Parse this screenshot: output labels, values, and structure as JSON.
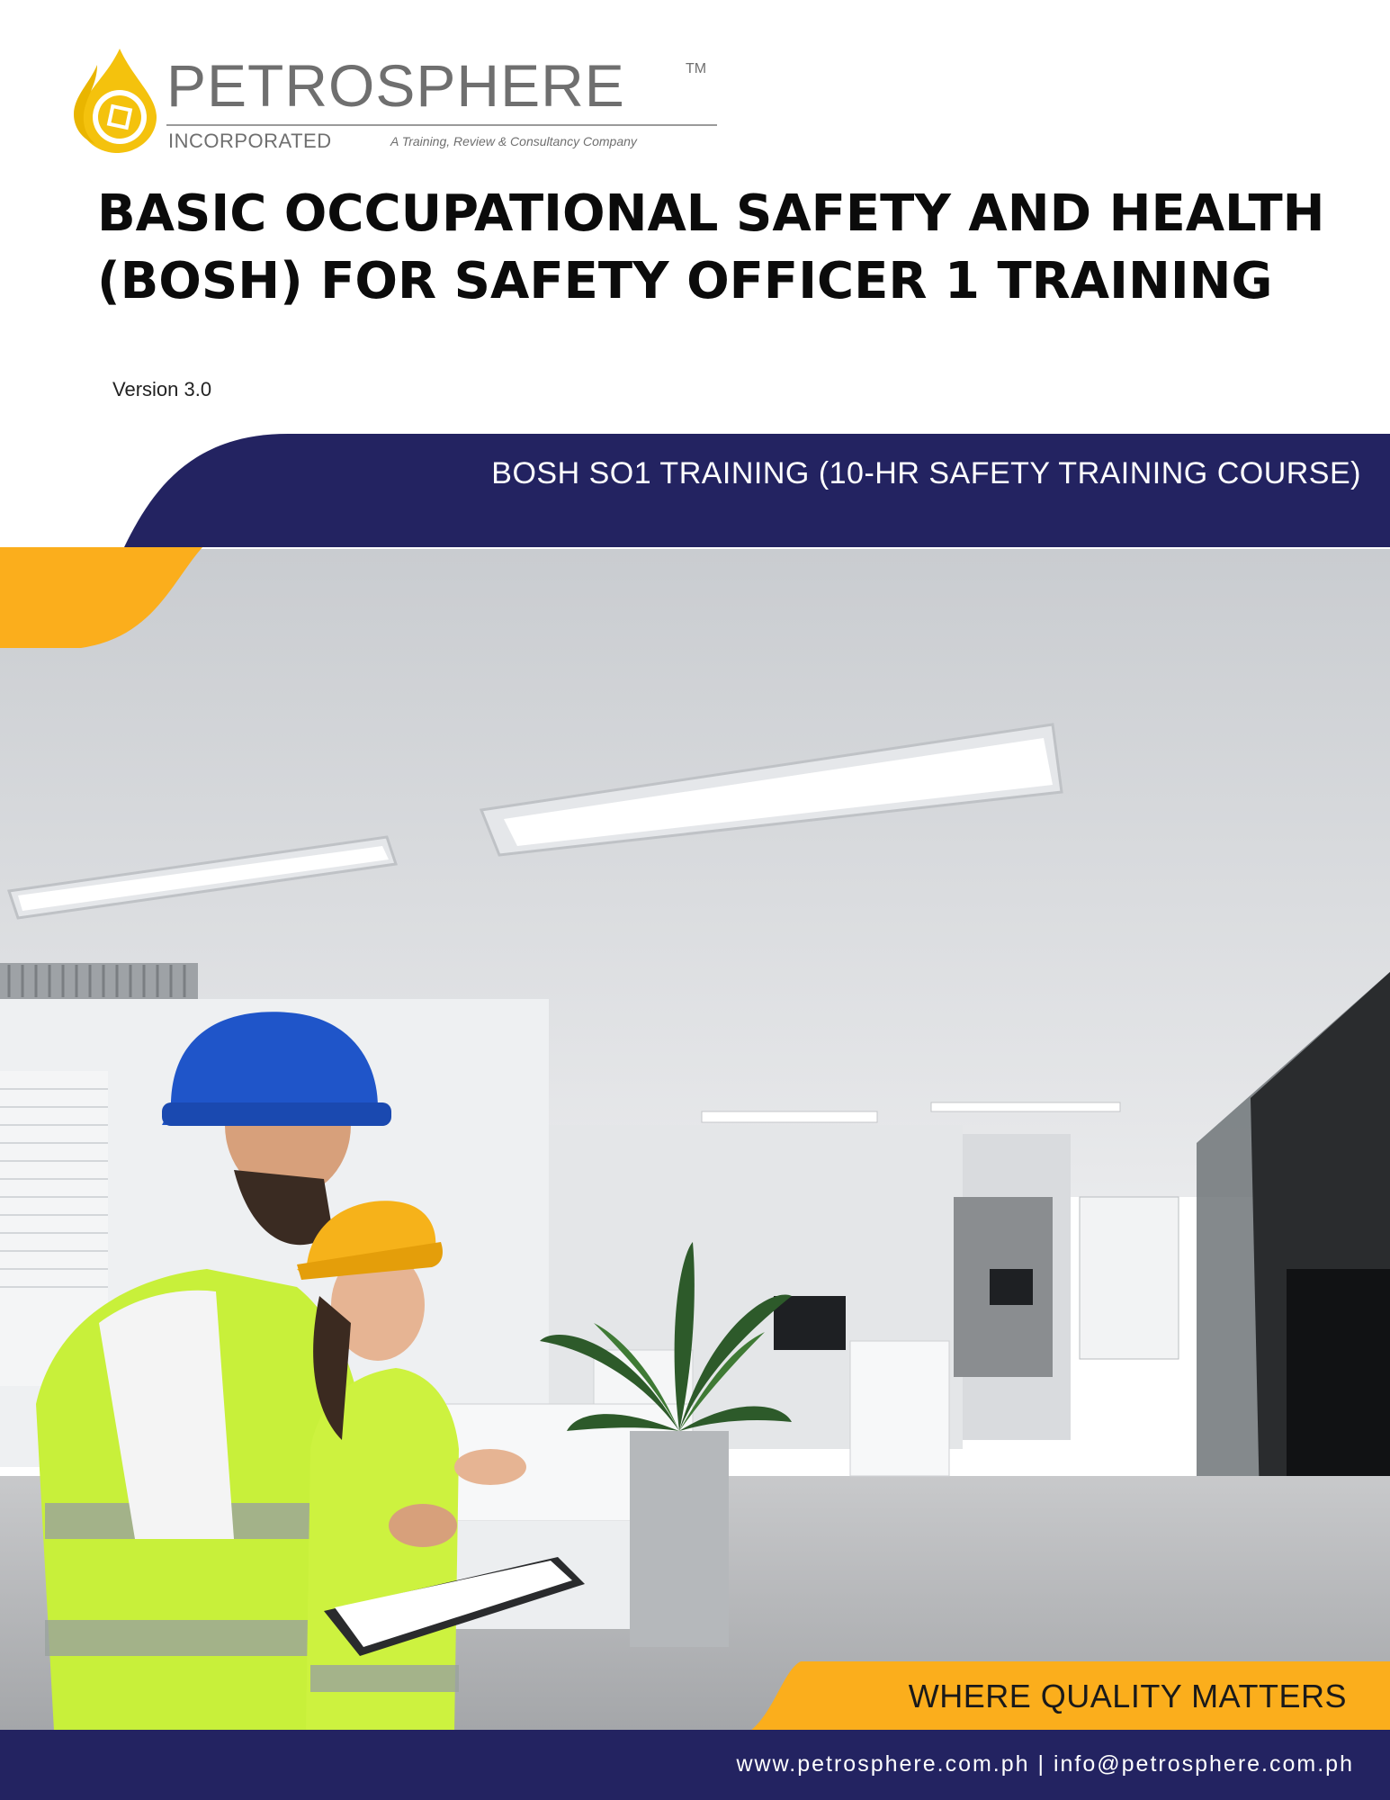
{
  "logo": {
    "name": "PETROSPHERE",
    "trademark": "TM",
    "subname": "INCORPORATED",
    "tagline": "A Training, Review & Consultancy Company"
  },
  "title": "BASIC OCCUPATIONAL SAFETY AND HEALTH (BOSH) FOR SAFETY OFFICER 1 TRAINING",
  "version": "Version 3.0",
  "band_text": "BOSH SO1 TRAINING (10-HR SAFETY TRAINING COURSE)",
  "tagline": "WHERE QUALITY MATTERS",
  "footer_contact": "www.petrosphere.com.ph | info@petrosphere.com.ph",
  "colors": {
    "navy": "#232361",
    "orange": "#FBAE1C",
    "logo_gray": "#6f6f6f",
    "logo_gold": "#F4C20D"
  }
}
